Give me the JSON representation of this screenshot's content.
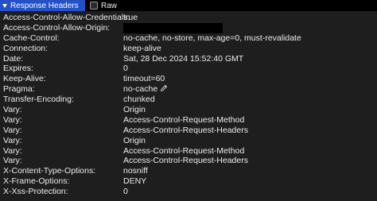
{
  "header": {
    "section_title": "Response Headers",
    "raw_label": "Raw",
    "raw_checked": false
  },
  "headers": [
    {
      "name": "Access-Control-Allow-Credentials:",
      "value": "true"
    },
    {
      "name": "Access-Control-Allow-Origin:",
      "value": "",
      "redacted": true
    },
    {
      "name": "Cache-Control:",
      "value": "no-cache, no-store, max-age=0, must-revalidate"
    },
    {
      "name": "Connection:",
      "value": "keep-alive"
    },
    {
      "name": "Date:",
      "value": "Sat, 28 Dec 2024 15:52:40 GMT"
    },
    {
      "name": "Expires:",
      "value": "0"
    },
    {
      "name": "Keep-Alive:",
      "value": "timeout=60"
    },
    {
      "name": "Pragma:",
      "value": "no-cache",
      "editable": true
    },
    {
      "name": "Transfer-Encoding:",
      "value": "chunked"
    },
    {
      "name": "Vary:",
      "value": "Origin"
    },
    {
      "name": "Vary:",
      "value": "Access-Control-Request-Method"
    },
    {
      "name": "Vary:",
      "value": "Access-Control-Request-Headers"
    },
    {
      "name": "Vary:",
      "value": "Origin"
    },
    {
      "name": "Vary:",
      "value": "Access-Control-Request-Method"
    },
    {
      "name": "Vary:",
      "value": "Access-Control-Request-Headers"
    },
    {
      "name": "X-Content-Type-Options:",
      "value": "nosniff"
    },
    {
      "name": "X-Frame-Options:",
      "value": "DENY"
    },
    {
      "name": "X-Xss-Protection:",
      "value": "0"
    }
  ],
  "colors": {
    "header_accent": "#2451c7",
    "panel_bg": "#1e1e1e",
    "text": "#ececec"
  }
}
